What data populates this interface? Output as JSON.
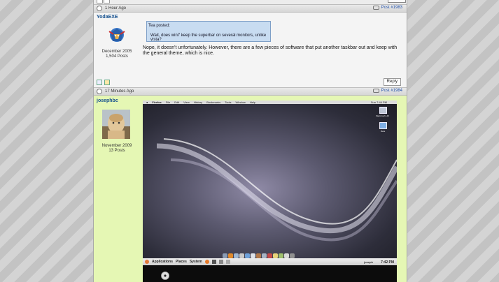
{
  "posts": [
    {
      "time": "1 Hour Ago",
      "post_number": "Post #1983",
      "username": "YodaEXE",
      "joined": "December 2005",
      "post_count": "1,504 Posts",
      "quote_header": "Tea posted:",
      "quote_text": "Wait, does win7 keep the superbar on several monitors, unlike vista?",
      "body": "Nope, it doesn't unfortunately. However, there are a few pieces of software that put another taskbar out and keep with the general theme, which is nice.",
      "reply_label": "Reply"
    },
    {
      "time": "17 Minutes Ago",
      "post_number": "Post #1984",
      "username": "josephbc",
      "joined": "November 2009",
      "post_count": "13 Posts"
    }
  ],
  "embedded_screenshot": {
    "menubar": {
      "app": "Firefox",
      "items": [
        "File",
        "Edit",
        "View",
        "History",
        "Bookmarks",
        "Tools",
        "Window",
        "Help"
      ],
      "clock": "Sun 7:44 PM"
    },
    "desktop_icons": [
      "Macintosh HD",
      "Beta"
    ],
    "panel": {
      "menus": [
        "Applications",
        "Places",
        "System"
      ],
      "user": "joseph",
      "clock": "7:42 PM"
    }
  },
  "colors": {
    "background_stripe_light": "#d4d4d4",
    "background_stripe_dark": "#c3c3c3",
    "post_alt_background": "#e5f7b4",
    "username_color": "#16518f",
    "link_color": "#1f4fa8",
    "quote_background": "#c8dcf1"
  }
}
